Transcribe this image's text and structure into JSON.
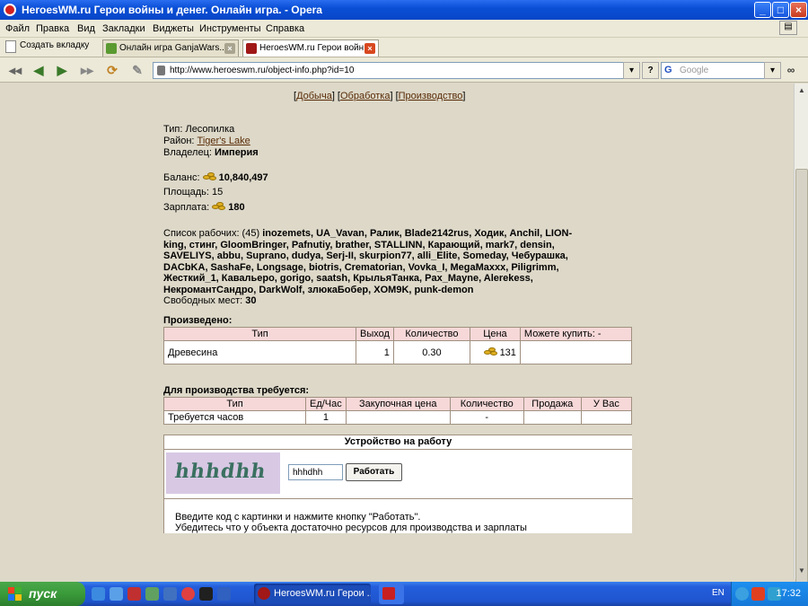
{
  "window": {
    "title": "HeroesWM.ru Герои войны и денег. Онлайн игра. - Opera"
  },
  "menu": [
    "Файл",
    "Правка",
    "Вид",
    "Закладки",
    "Виджеты",
    "Инструменты",
    "Справка"
  ],
  "tabs": {
    "new_tab": "Создать вкладку",
    "items": [
      "Онлайн игра GanjaWars...",
      "HeroesWM.ru Герои войн..."
    ]
  },
  "address": {
    "url": "http://www.heroeswm.ru/object-info.php?id=10",
    "search_placeholder": "Google"
  },
  "page": {
    "nav": [
      "Добыча",
      "Обработка",
      "Производство"
    ],
    "type_label": "Тип:",
    "type_value": "Лесопилка",
    "district_label": "Район:",
    "district_value": "Tiger's Lake",
    "owner_label": "Владелец:",
    "owner_value": "Империя",
    "balance_label": "Баланс:",
    "balance_value": "10,840,497",
    "area_label": "Площадь:",
    "area_value": "15",
    "salary_label": "Зарплата:",
    "salary_value": "180",
    "workers_label": "Список рабочих: (45)",
    "workers_lines": [
      "inozemets, UA_Vavan, Ралик, Blade2142rus, Ходик, Anchil, LION-",
      "king, стинг, GloomBringer, Pafnutiy, brather, STALLINN, Карающий, mark7, densin,",
      "SAVELIYS, abbu, Suprano, dudya, Serj-II, skurpion77, alli_Elite, Someday, Чебурашка,",
      "DACbKA, SashaFe, Longsage, biotris, Crematorian, Vovka_I, MegaMaxxx, Piligrimm,",
      "Жесткий_1, Кавальеро, gorigo, saatsh, КрыльяТанка, Pax_Mayne, Alerekess,",
      "НекромантСандро, DarkWolf, злюкаБобер, XOM9K, punk-demon"
    ],
    "free_label": "Свободных мест:",
    "free_value": "30",
    "produced_label": "Произведено:",
    "produced_headers": [
      "Тип",
      "Выход",
      "Количество",
      "Цена",
      "Можете купить: -"
    ],
    "produced_rows": [
      {
        "type": "Древесина",
        "output": "1",
        "qty": "0.30",
        "price": "131",
        "buy": ""
      }
    ],
    "required_label": "Для производства требуется:",
    "required_headers": [
      "Тип",
      "Ед/Час",
      "Закупочная цена",
      "Количество",
      "Продажа",
      "У Вас"
    ],
    "required_rows": [
      {
        "type": "Требуется часов",
        "unit": "1",
        "price": "",
        "qty": "-",
        "sell": "",
        "have": ""
      }
    ],
    "hire_title": "Устройство на работу",
    "captcha_text": "hhhdhh",
    "code_value": "hhhdhh",
    "work_button": "Работать",
    "note1": "Введите код с картинки и нажмите кнопку \"Работать\".",
    "note2": "Убедитесь что у объекта достаточно ресурсов для производства и зарплаты"
  },
  "taskbar": {
    "start": "пуск",
    "task_item": "HeroesWM.ru Герои ...",
    "lang": "EN",
    "time": "17:32"
  }
}
